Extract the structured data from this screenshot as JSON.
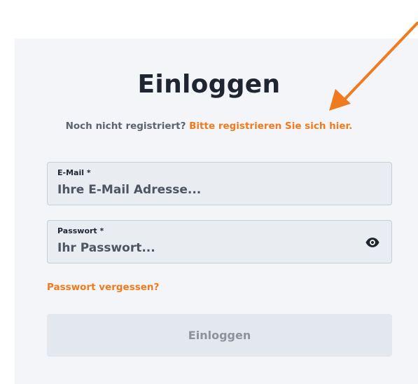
{
  "login": {
    "title": "Einloggen",
    "register_prompt": "Noch nicht registriert?",
    "register_link": "Bitte registrieren Sie sich hier.",
    "email": {
      "label": "E-Mail *",
      "placeholder": "Ihre E-Mail Adresse...",
      "value": ""
    },
    "password": {
      "label": "Passwort *",
      "placeholder": "Ihr Passwort...",
      "value": "",
      "toggle_icon": "eye-icon"
    },
    "forgot_link": "Passwort vergessen?",
    "submit_label": "Einloggen"
  },
  "annotation": {
    "arrow_color": "#f07b1e"
  },
  "colors": {
    "accent": "#f07b1e",
    "card_background": "#f3f5f8",
    "heading": "#1f2632"
  }
}
